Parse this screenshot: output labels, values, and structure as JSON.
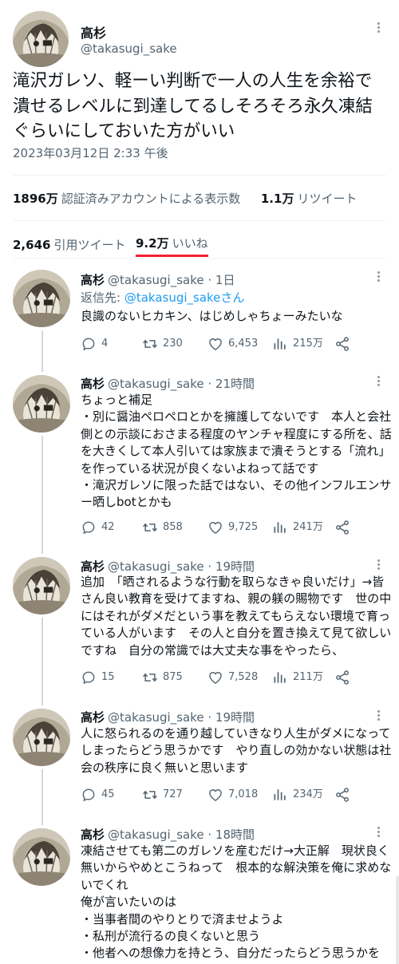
{
  "main_tweet": {
    "author_name": "高杉",
    "author_handle": "@takasugi_sake",
    "text_lines": [
      "滝沢ガレソ、軽ーい判断で一人の人生を余裕で",
      "潰せるレベルに到達してるしそろそろ永久凍結",
      "ぐらいにしておいた方がいい"
    ],
    "timestamp": "2023年03月12日 2:33 午後",
    "views_count": "1896万",
    "views_label": "認証済みアカウントによる表示数",
    "retweets_count": "1.1万",
    "retweets_label": "リツイート",
    "quotes_count": "2,646",
    "quotes_label": "引用ツイート",
    "likes_count": "9.2万",
    "likes_label": "いいね"
  },
  "replies": [
    {
      "name": "高杉",
      "handle": "@takasugi_sake",
      "time": "· 1日",
      "reply_prefix": "返信先: ",
      "reply_to": "@takasugi_sakeさん",
      "lines": [
        "良識のないヒカキン、はじめしゃちょーみたいな"
      ],
      "replies": "4",
      "retweets": "230",
      "likes": "6,453",
      "views": "215万"
    },
    {
      "name": "高杉",
      "handle": "@takasugi_sake",
      "time": "· 21時間",
      "lines": [
        "ちょっと補足",
        "・別に醤油ペロペロとかを擁護してないです　本人と会社",
        "側との示談におさまる程度のヤンチャ程度にする所を、話",
        "を大きくして本人引いては家族まで潰そうとする「流れ」",
        "を作っている状況が良くないよねって話です",
        "・滝沢ガレソに限った話ではない、その他インフルエンサ",
        "ー晒しbotとかも"
      ],
      "replies": "42",
      "retweets": "858",
      "likes": "9,725",
      "views": "241万"
    },
    {
      "name": "高杉",
      "handle": "@takasugi_sake",
      "time": "· 19時間",
      "lines": [
        "追加　「晒されるような行動を取らなきゃ良いだけ」→皆",
        "さん良い教育を受けてますね、親の躾の賜物です　世の中",
        "にはそれがダメだという事を教えてもらえない環境で育っ",
        "ている人がいます　その人と自分を置き換えて見て欲しい",
        "ですね　自分の常識では大丈夫な事をやったら、"
      ],
      "replies": "15",
      "retweets": "875",
      "likes": "7,528",
      "views": "211万"
    },
    {
      "name": "高杉",
      "handle": "@takasugi_sake",
      "time": "· 19時間",
      "lines": [
        "人に怒られるのを通り越していきなり人生がダメになって",
        "しまったらどう思うかです　やり直しの効かない状態は社",
        "会の秩序に良く無いと思います"
      ],
      "replies": "45",
      "retweets": "727",
      "likes": "7,018",
      "views": "234万"
    },
    {
      "name": "高杉",
      "handle": "@takasugi_sake",
      "time": "· 18時間",
      "lines": [
        "凍結させても第二のガレソを産むだけ→大正解　現状良く",
        "無いからやめとこうねって　根本的な解決策を俺に求めな",
        "いでくれ",
        "俺が言いたいのは",
        "・当事者間のやりとりで済ませようよ",
        "・私刑が流行るの良くないと思う",
        "・他者への想像力を持とう、自分だったらどう思うかを"
      ]
    }
  ],
  "icons": {
    "more": "more-options-icon",
    "reply": "reply-icon",
    "retweet": "retweet-icon",
    "like": "like-icon",
    "views": "views-icon",
    "share": "share-icon"
  },
  "colors": {
    "text": "#0f1419",
    "secondary": "#536471",
    "link": "#1d9bf0",
    "likes_underline": "#f4212e",
    "thread_line": "#cfd9de",
    "divider": "#eff3f4"
  }
}
